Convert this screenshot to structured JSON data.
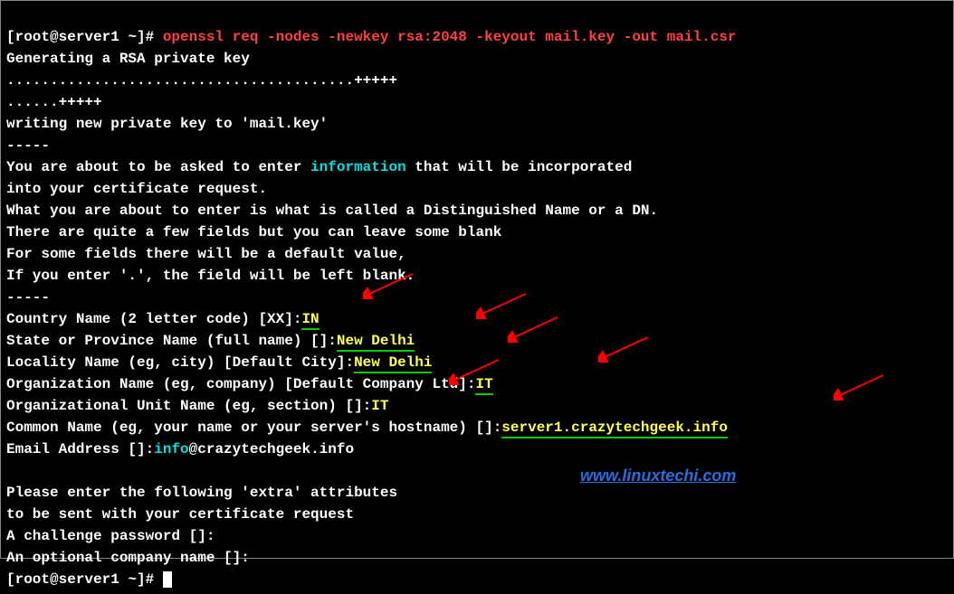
{
  "prompt1_user": "[root@server1 ~]# ",
  "command": "openssl req -nodes -newkey rsa:2048 -keyout mail.key -out mail.csr",
  "gen": "Generating a RSA private key",
  "dots1": "........................................+++++",
  "dots2": "......+++++",
  "writing": "writing new private key to 'mail.key'",
  "dash1": "-----",
  "intro1a": "You are about to be asked to enter ",
  "intro1_info": "information",
  "intro1b": " that will be incorporated",
  "intro2": "into your certificate request.",
  "intro3": "What you are about to enter is what is called a Distinguished Name or a DN.",
  "intro4": "There are quite a few fields but you can leave some blank",
  "intro5": "For some fields there will be a default value,",
  "intro6": "If you enter '.', the field will be left blank.",
  "dash2": "-----",
  "country_prompt": "Country Name (2 letter code) [XX]:",
  "country_val": "IN",
  "state_prompt": "State or Province Name (full name) []:",
  "state_val": "New Delhi",
  "locality_prompt": "Locality Name (eg, city) [Default City]:",
  "locality_val": "New Delhi",
  "org_prompt": "Organization Name (eg, company) [Default Company Ltd]:",
  "org_val": "IT",
  "ou_prompt": "Organizational Unit Name (eg, section) []:",
  "ou_val": "IT",
  "cn_prompt": "Common Name (eg, your name or your server's hostname) []:",
  "cn_val": "server1.crazytechgeek.info",
  "email_prompt": "Email Address []:",
  "email_local": "info",
  "email_domain": "@crazytechgeek.info",
  "extra1": "Please enter the following 'extra' attributes",
  "extra2": "to be sent with your certificate request",
  "challenge": "A challenge password []:",
  "optcompany": "An optional company name []:",
  "prompt2_user": "[root@server1 ~]# ",
  "watermark": "www.linuxtechi.com"
}
